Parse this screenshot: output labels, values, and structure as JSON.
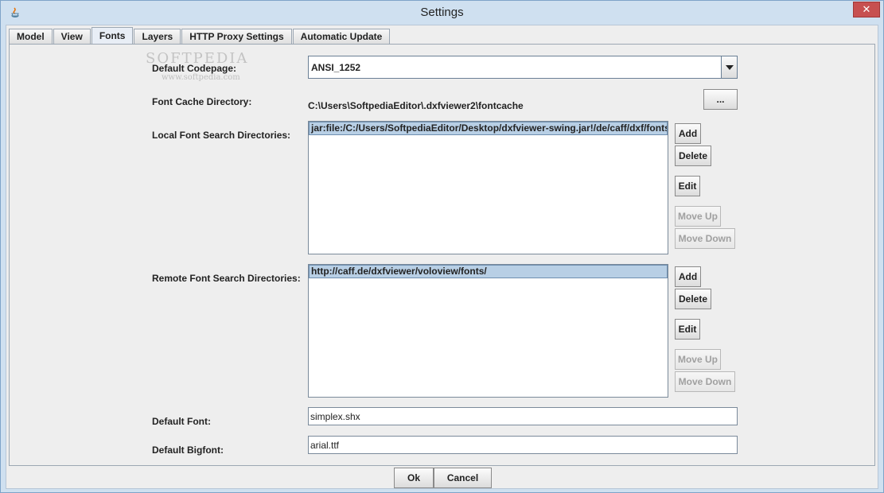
{
  "window": {
    "title": "Settings",
    "close_label": "✕"
  },
  "tabs": [
    {
      "label": "Model"
    },
    {
      "label": "View"
    },
    {
      "label": "Fonts"
    },
    {
      "label": "Layers"
    },
    {
      "label": "HTTP Proxy Settings"
    },
    {
      "label": "Automatic Update"
    }
  ],
  "fonts": {
    "default_codepage_label": "Default Codepage:",
    "default_codepage_value": "ANSI_1252",
    "font_cache_label": "Font Cache Directory:",
    "font_cache_value": "C:\\Users\\SoftpediaEditor\\.dxfviewer2\\fontcache",
    "browse_label": "...",
    "local_label": "Local Font Search Directories:",
    "local_items": [
      "jar:file:/C:/Users/SoftpediaEditor/Desktop/dxfviewer-swing.jar!/de/caff/dxf/fonts/"
    ],
    "remote_label": "Remote Font Search Directories:",
    "remote_items": [
      "http://caff.de/dxfviewer/voloview/fonts/"
    ],
    "default_font_label": "Default Font:",
    "default_font_value": "simplex.shx",
    "default_bigfont_label": "Default Bigfont:",
    "default_bigfont_value": "arial.ttf"
  },
  "list_buttons": {
    "add": "Add",
    "delete": "Delete",
    "edit": "Edit",
    "move_up": "Move Up",
    "move_down": "Move Down"
  },
  "dialog_buttons": {
    "ok": "Ok",
    "cancel": "Cancel"
  },
  "watermark": {
    "text": "SOFTPEDIA",
    "url": "www.softpedia.com"
  }
}
